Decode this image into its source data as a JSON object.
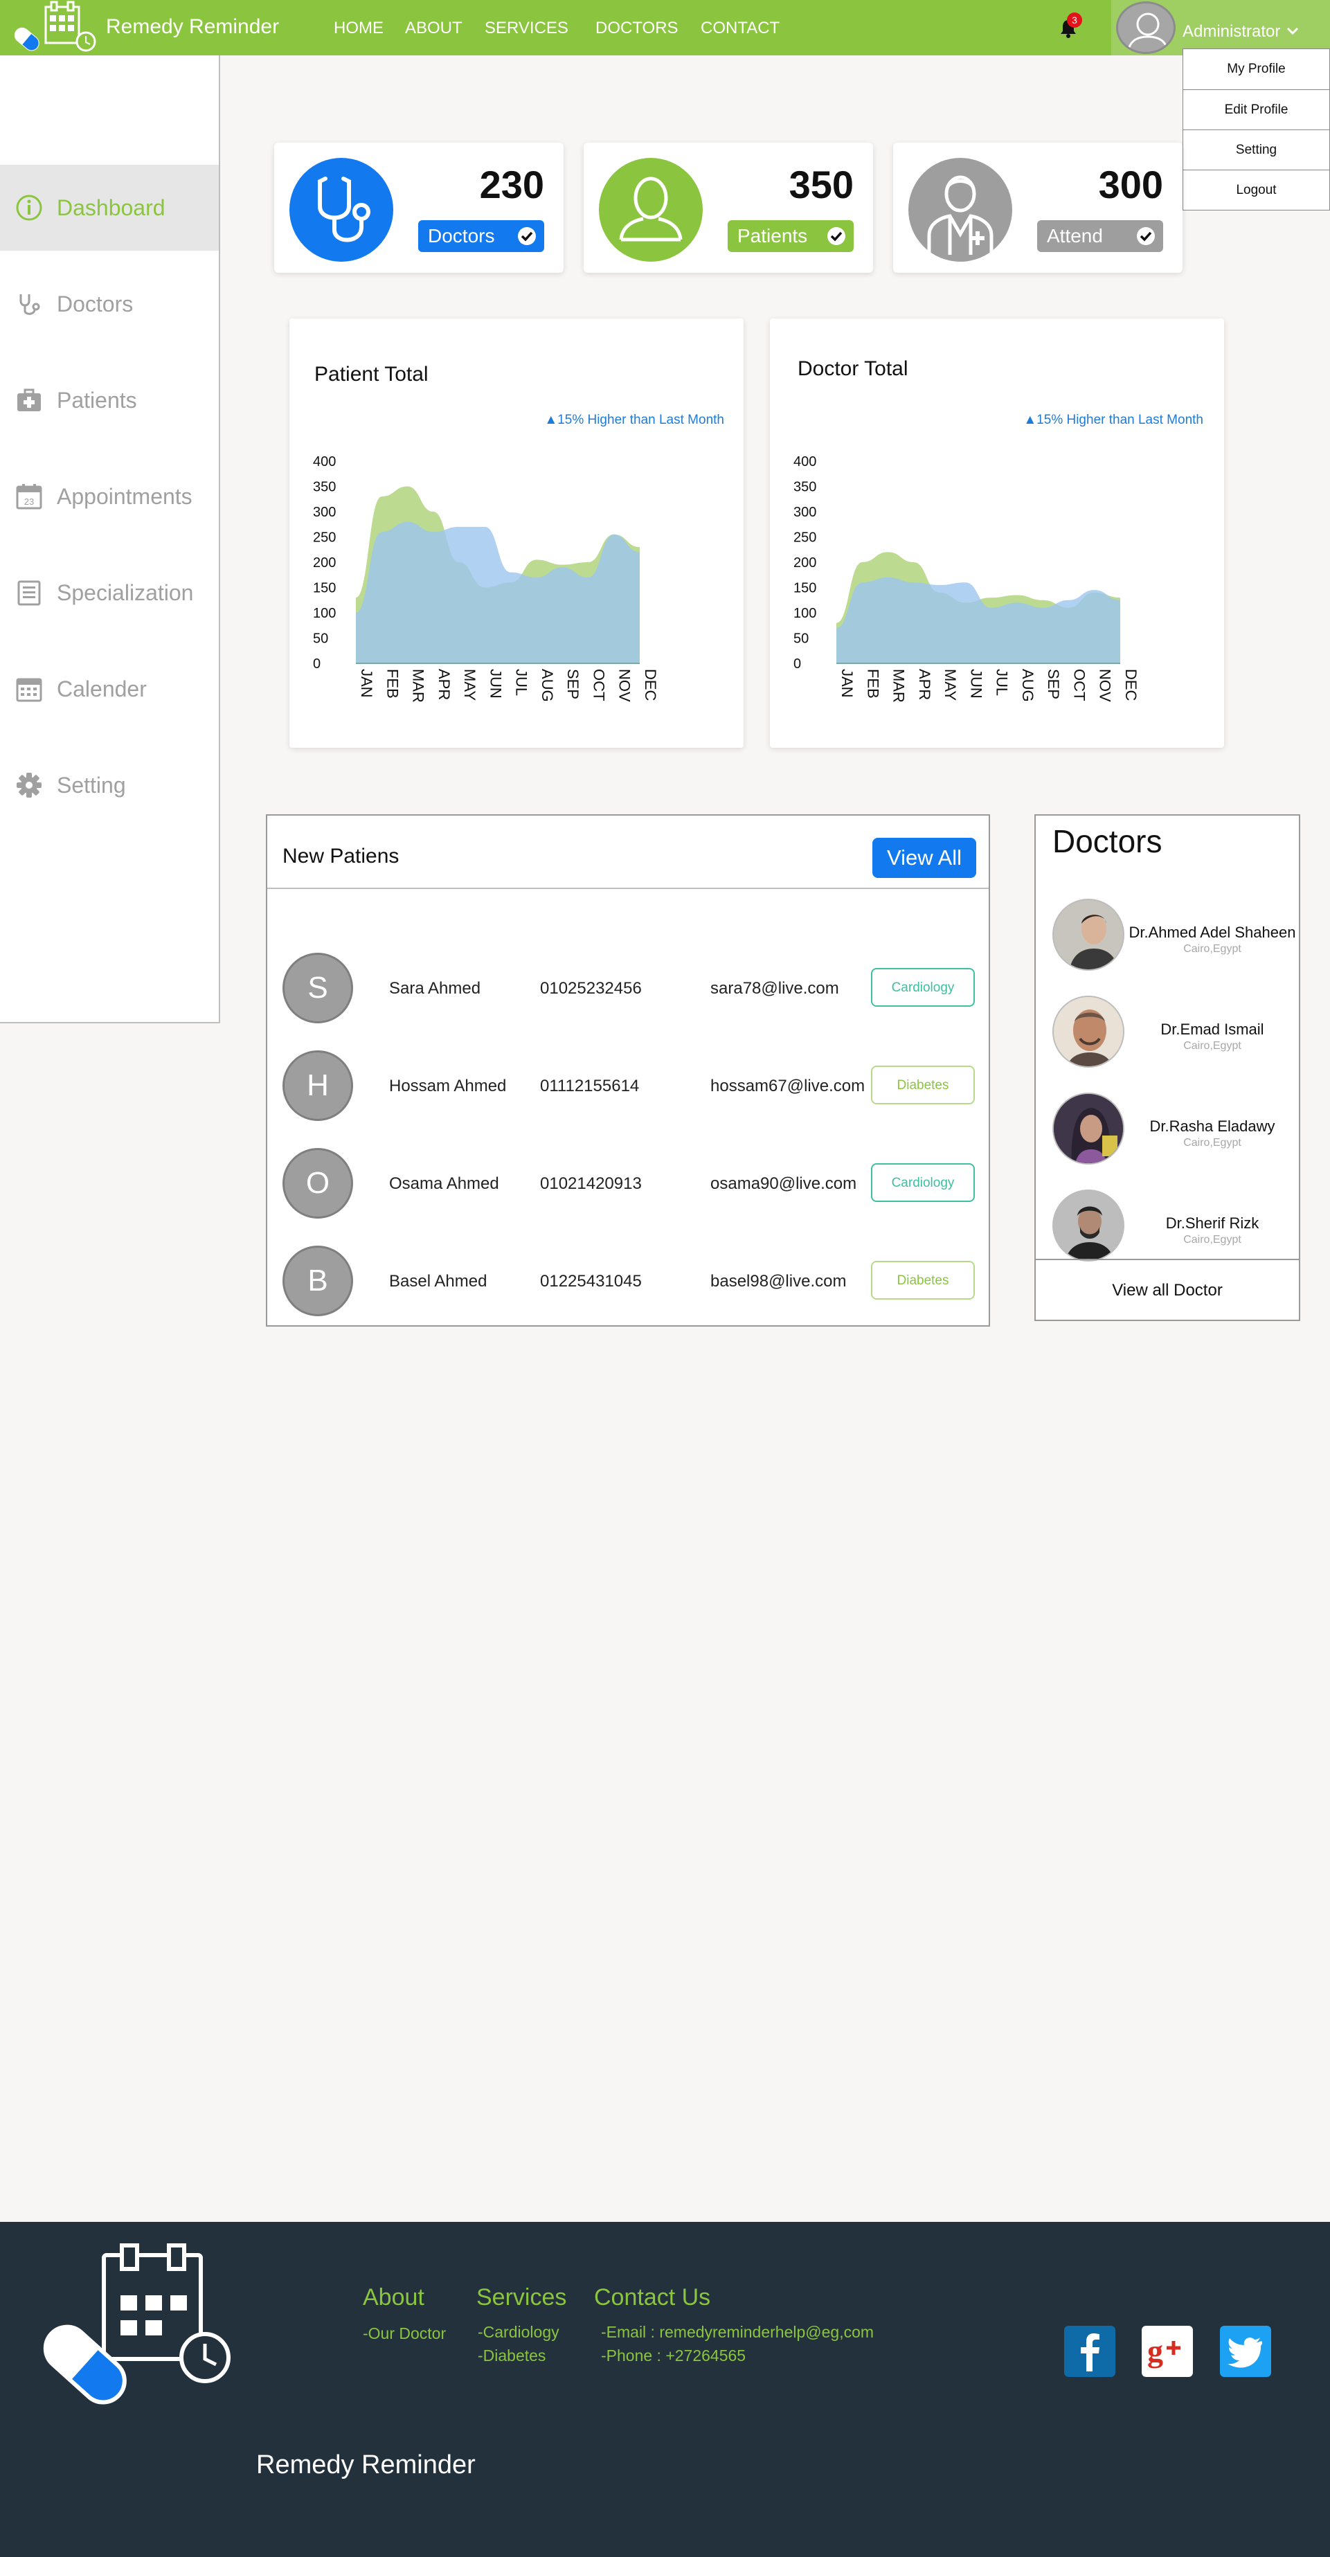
{
  "app": {
    "name": "Remedy Reminder"
  },
  "nav": {
    "items": [
      "HOME",
      "ABOUT",
      "SERVICES",
      "DOCTORS",
      "CONTACT"
    ]
  },
  "notifications": {
    "count": "3"
  },
  "user": {
    "name": "Administrator",
    "menu": [
      "My Profile",
      "Edit Profile",
      "Setting",
      "Logout"
    ]
  },
  "sidebar": {
    "items": [
      {
        "label": "Dashboard",
        "icon": "info-icon",
        "active": true
      },
      {
        "label": "Doctors",
        "icon": "stethoscope-icon"
      },
      {
        "label": "Patients",
        "icon": "first-aid-icon"
      },
      {
        "label": "Appointments",
        "icon": "calendar-day-icon"
      },
      {
        "label": "Specialization",
        "icon": "clipboard-icon"
      },
      {
        "label": "Calender",
        "icon": "calendar-grid-icon"
      },
      {
        "label": "Setting",
        "icon": "gear-icon"
      }
    ]
  },
  "stats": [
    {
      "value": "230",
      "label": "Doctors",
      "color": "#1279ef"
    },
    {
      "value": "350",
      "label": "Patients",
      "color": "#8bc53f"
    },
    {
      "value": "300",
      "label": "Attend",
      "color": "#9e9e9e"
    }
  ],
  "charts_text": {
    "patient_title": "Patient Total",
    "doctor_title": "Doctor Total",
    "note": "▲15% Higher than Last Month"
  },
  "chart_data": [
    {
      "type": "area",
      "title": "Patient Total",
      "categories": [
        "JAN",
        "FEB",
        "MAR",
        "APR",
        "MAY",
        "JUN",
        "JUL",
        "AUG",
        "SEP",
        "OCT",
        "NOV",
        "DEC"
      ],
      "yticks": [
        0,
        50,
        100,
        150,
        200,
        250,
        300,
        350,
        400
      ],
      "ylim": [
        0,
        400
      ],
      "series": [
        {
          "values": [
            130,
            330,
            350,
            300,
            200,
            150,
            160,
            205,
            195,
            200,
            255,
            230
          ],
          "color": "#b9d98a"
        },
        {
          "values": [
            100,
            260,
            280,
            260,
            270,
            270,
            180,
            170,
            190,
            170,
            255,
            220
          ],
          "color": "#9cc6ef"
        }
      ]
    },
    {
      "type": "area",
      "title": "Doctor Total",
      "categories": [
        "JAN",
        "FEB",
        "MAR",
        "APR",
        "MAY",
        "JUN",
        "JUL",
        "AUG",
        "SEP",
        "OCT",
        "NOV",
        "DEC"
      ],
      "yticks": [
        0,
        50,
        100,
        150,
        200,
        250,
        300,
        350,
        400
      ],
      "ylim": [
        0,
        400
      ],
      "series": [
        {
          "values": [
            80,
            200,
            220,
            200,
            140,
            120,
            130,
            135,
            125,
            110,
            140,
            130
          ],
          "color": "#b9d98a"
        },
        {
          "values": [
            70,
            160,
            170,
            160,
            155,
            160,
            110,
            120,
            110,
            125,
            145,
            125
          ],
          "color": "#9cc6ef"
        }
      ]
    }
  ],
  "new_patients": {
    "title": "New Patiens",
    "view_all": "View All",
    "rows": [
      {
        "initial": "S",
        "name": "Sara Ahmed",
        "phone": "01025232456",
        "email": "sara78@live.com",
        "tag": "Cardiology",
        "tag_color": "#3fbfa0"
      },
      {
        "initial": "H",
        "name": "Hossam Ahmed",
        "phone": "01112155614",
        "email": "hossam67@live.com",
        "tag": "Diabetes",
        "tag_color": "#8bc53f"
      },
      {
        "initial": "O",
        "name": "Osama Ahmed",
        "phone": "01021420913",
        "email": "osama90@live.com",
        "tag": "Cardiology",
        "tag_color": "#3fbfa0"
      },
      {
        "initial": "B",
        "name": "Basel Ahmed",
        "phone": "01225431045",
        "email": "basel98@live.com",
        "tag": "Diabetes",
        "tag_color": "#8bc53f"
      }
    ]
  },
  "doctors_panel": {
    "title": "Doctors",
    "view_all": "View all Doctor",
    "items": [
      {
        "name": "Dr.Ahmed Adel Shaheen",
        "location": "Cairo,Egypt"
      },
      {
        "name": "Dr.Emad Ismail",
        "location": "Cairo,Egypt"
      },
      {
        "name": "Dr.Rasha Eladawy",
        "location": "Cairo,Egypt"
      },
      {
        "name": "Dr.Sherif Rizk",
        "location": "Cairo,Egypt"
      }
    ]
  },
  "footer": {
    "about": {
      "title": "About",
      "links": [
        "-Our Doctor"
      ]
    },
    "services": {
      "title": "Services",
      "links": [
        "-Cardiology",
        "-Diabetes"
      ]
    },
    "contact": {
      "title": "Contact Us",
      "email": "-Email : remedyreminderhelp@eg,com",
      "phone": "-Phone : +27264565"
    },
    "brand": "Remedy Reminder",
    "social": [
      {
        "icon": "facebook-icon",
        "color": "#0e6ba8"
      },
      {
        "icon": "google-plus-icon",
        "color": "#ffffff"
      },
      {
        "icon": "twitter-icon",
        "color": "#1da1f2"
      }
    ]
  }
}
